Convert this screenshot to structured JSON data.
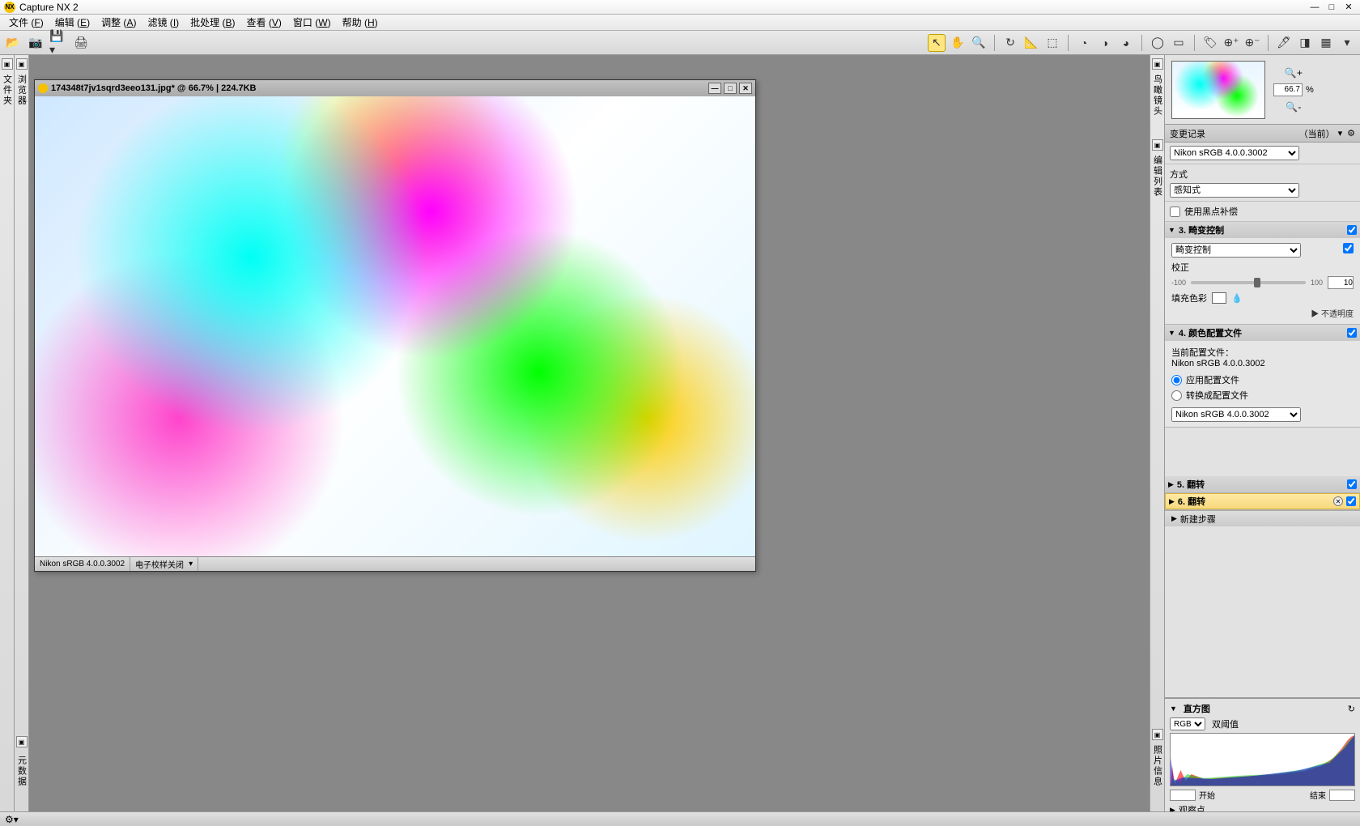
{
  "app": {
    "title": "Capture NX 2"
  },
  "win": {
    "min": "—",
    "max": "□",
    "close": "✕"
  },
  "menu": [
    {
      "label": "文件",
      "key": "F"
    },
    {
      "label": "编辑",
      "key": "E"
    },
    {
      "label": "调整",
      "key": "A"
    },
    {
      "label": "滤镜",
      "key": "I"
    },
    {
      "label": "批处理",
      "key": "B"
    },
    {
      "label": "查看",
      "key": "V"
    },
    {
      "label": "窗口",
      "key": "W"
    },
    {
      "label": "帮助",
      "key": "H"
    }
  ],
  "leftRails": {
    "tab1": "文件夹",
    "tab2": "浏览器",
    "tab3": "元数据"
  },
  "rightRails": {
    "tab1": "鸟瞰镜头",
    "tab2": "编辑列表",
    "tab3": "照片信息"
  },
  "doc": {
    "title": "174348t7jv1sqrd3eeo131.jpg* @ 66.7%  |  224.7KB",
    "profile": "Nikon sRGB 4.0.0.3002",
    "softproof": "电子校样关闭",
    "min": "—",
    "max": "□",
    "close": "✕"
  },
  "birdeye": {
    "zoom": "66.7",
    "pct": "%"
  },
  "editHeader": {
    "label": "变更记录",
    "current": "（当前）"
  },
  "profileRow": {
    "value": "Nikon sRGB 4.0.0.3002"
  },
  "method": {
    "label": "方式",
    "value": "感知式"
  },
  "blackpoint": {
    "label": "使用黑点补偿"
  },
  "step3": {
    "title": "3. 畸变控制",
    "select": "畸变控制",
    "corrLabel": "校正",
    "rangeLow": "-100",
    "rangeHigh": "100",
    "corrValue": "10",
    "fillLabel": "填充色彩",
    "opacity": "▶ 不透明度"
  },
  "step4": {
    "title": "4. 颜色配置文件",
    "curProfileLabel": "当前配置文件：",
    "curProfile": "Nikon sRGB 4.0.0.3002",
    "radio1": "应用配置文件",
    "radio2": "转换成配置文件",
    "select": "Nikon sRGB 4.0.0.3002"
  },
  "step5": {
    "title": "5. 翻转"
  },
  "step6": {
    "title": "6. 翻转"
  },
  "newStep": {
    "label": "新建步骤"
  },
  "hist": {
    "title": "直方图",
    "channel": "RGB",
    "dual": "双阈值",
    "start": "开始",
    "end": "结束",
    "obs": "观察点"
  }
}
